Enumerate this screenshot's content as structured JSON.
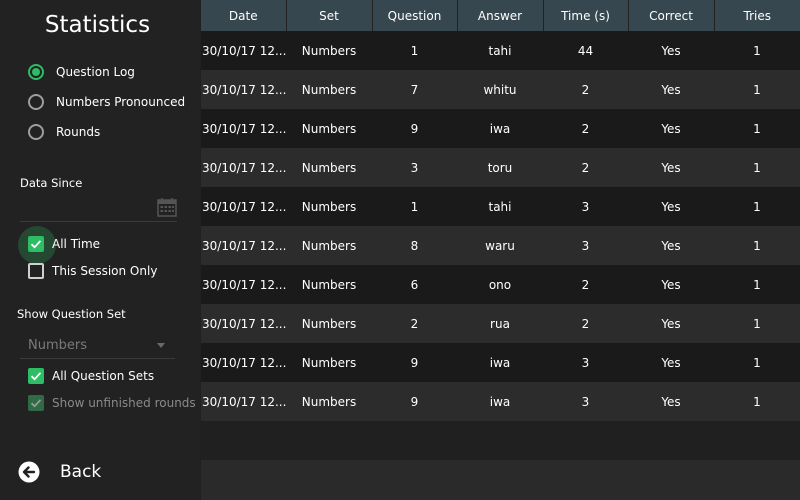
{
  "sidebar": {
    "title": "Statistics",
    "view_options": [
      {
        "label": "Question Log",
        "checked": true
      },
      {
        "label": "Numbers Pronounced",
        "checked": false
      },
      {
        "label": "Rounds",
        "checked": false
      }
    ],
    "data_since_label": "Data Since",
    "date_value": "",
    "time_options": [
      {
        "label": "All Time",
        "checked": true
      },
      {
        "label": "This Session Only",
        "checked": false
      }
    ],
    "show_question_set_label": "Show Question Set",
    "question_set_select": "Numbers",
    "set_options": [
      {
        "label": "All Question Sets",
        "checked": true,
        "disabled": false
      },
      {
        "label": "Show unfinished rounds",
        "checked": true,
        "disabled": true
      }
    ],
    "back_label": "Back"
  },
  "table": {
    "columns": [
      "Date",
      "Set",
      "Question",
      "Answer",
      "Time (s)",
      "Correct",
      "Tries"
    ],
    "rows": [
      [
        "30/10/17 12...",
        "Numbers",
        "1",
        "tahi",
        "44",
        "Yes",
        "1"
      ],
      [
        "30/10/17 12...",
        "Numbers",
        "7",
        "whitu",
        "2",
        "Yes",
        "1"
      ],
      [
        "30/10/17 12...",
        "Numbers",
        "9",
        "iwa",
        "2",
        "Yes",
        "1"
      ],
      [
        "30/10/17 12...",
        "Numbers",
        "3",
        "toru",
        "2",
        "Yes",
        "1"
      ],
      [
        "30/10/17 12...",
        "Numbers",
        "1",
        "tahi",
        "3",
        "Yes",
        "1"
      ],
      [
        "30/10/17 12...",
        "Numbers",
        "8",
        "waru",
        "3",
        "Yes",
        "1"
      ],
      [
        "30/10/17 12...",
        "Numbers",
        "6",
        "ono",
        "2",
        "Yes",
        "1"
      ],
      [
        "30/10/17 12...",
        "Numbers",
        "2",
        "rua",
        "2",
        "Yes",
        "1"
      ],
      [
        "30/10/17 12...",
        "Numbers",
        "9",
        "iwa",
        "3",
        "Yes",
        "1"
      ],
      [
        "30/10/17 12...",
        "Numbers",
        "9",
        "iwa",
        "3",
        "Yes",
        "1"
      ]
    ]
  },
  "colors": {
    "accent": "#2dbd64",
    "header_bg": "#37474f",
    "row_dark": "#1a1a1a",
    "row_light": "#2c2c2c"
  },
  "icons": {
    "calendar": "calendar-icon",
    "back": "back-arrow-icon",
    "check": "check-icon",
    "dropdown": "chevron-down-icon"
  }
}
